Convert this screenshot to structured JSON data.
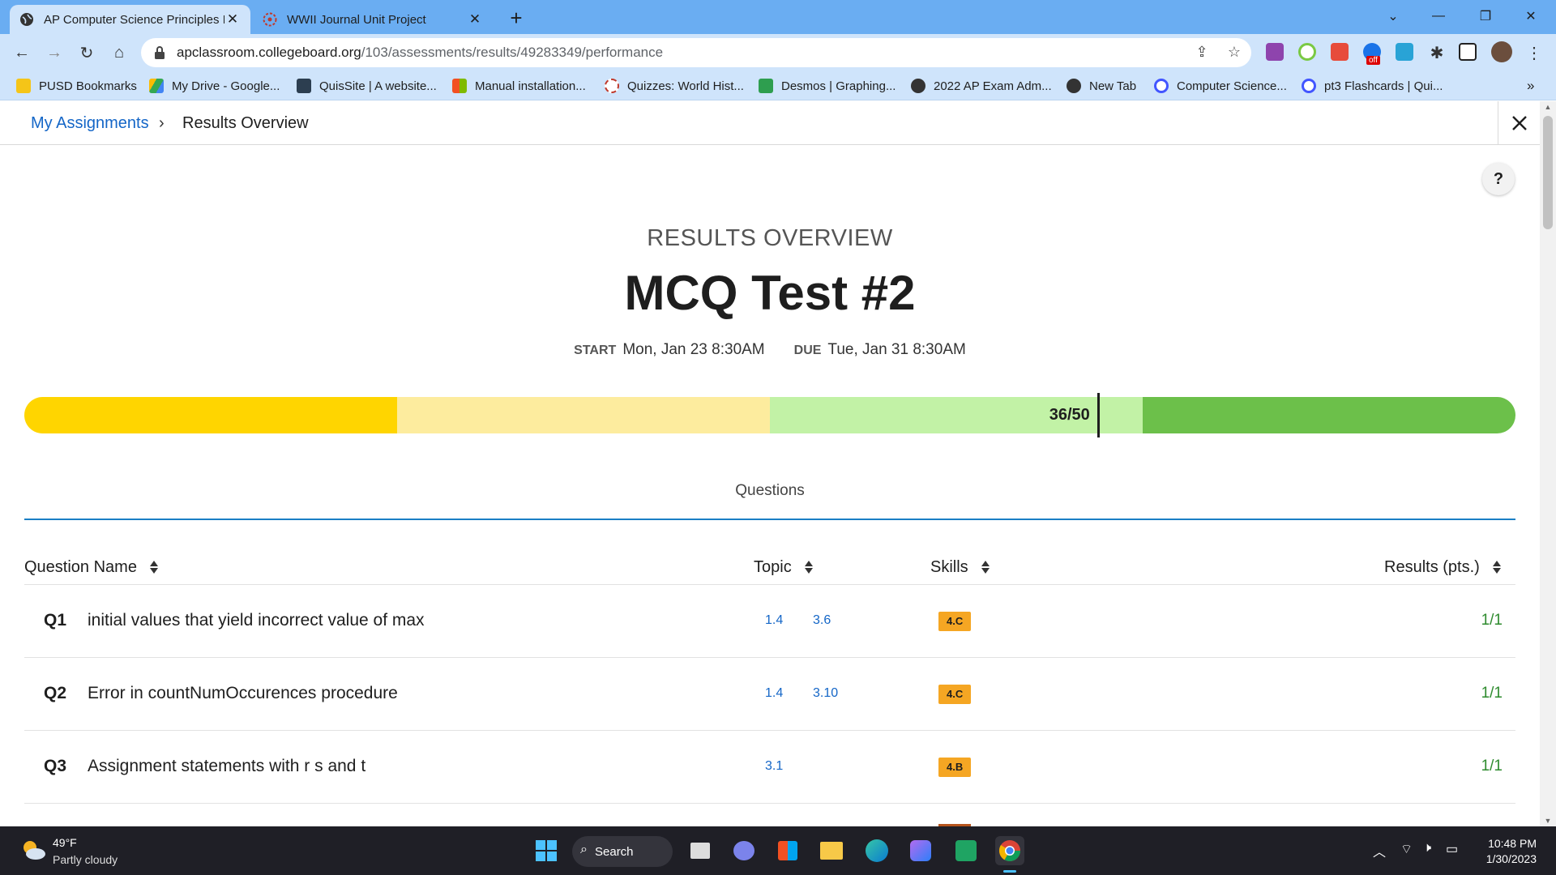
{
  "browser": {
    "tabs": [
      {
        "title": "AP Computer Science Principles I",
        "active": true
      },
      {
        "title": "WWII Journal Unit Project",
        "active": false
      }
    ],
    "new_tab": "+",
    "url_domain": "apclassroom.collegeboard.org",
    "url_path": "/103/assessments/results/49283349/performance",
    "bookmarks": [
      "PUSD Bookmarks",
      "My Drive - Google...",
      "QuisSite | A website...",
      "Manual installation...",
      "Quizzes: World Hist...",
      "Desmos | Graphing...",
      "2022 AP Exam Adm...",
      "New Tab",
      "Computer Science...",
      "pt3 Flashcards | Qui..."
    ],
    "bookmarks_overflow": "»",
    "extension_badge": "off"
  },
  "breadcrumb": {
    "link": "My Assignments",
    "separator": "›",
    "current": "Results Overview"
  },
  "help_label": "?",
  "header": {
    "overline": "RESULTS OVERVIEW",
    "title": "MCQ Test #2",
    "start_label": "START",
    "start_value": "Mon, Jan 23 8:30AM",
    "due_label": "DUE",
    "due_value": "Tue, Jan 31 8:30AM"
  },
  "score": {
    "label": "36/50",
    "earned": 36,
    "total": 50,
    "segment_colors": [
      "#ffd500",
      "#fdec9e",
      "#c2f2a6",
      "#6cc04a"
    ]
  },
  "questions_tab": "Questions",
  "table": {
    "columns": [
      "Question Name",
      "Topic",
      "Skills",
      "Results (pts.)"
    ],
    "rows": [
      {
        "num": "Q1",
        "name": "initial values that yield incorrect value of max",
        "topics": [
          "1.4",
          "3.6"
        ],
        "skill": "4.C",
        "result": "1/1"
      },
      {
        "num": "Q2",
        "name": "Error in countNumOccurences procedure",
        "topics": [
          "1.4",
          "3.10"
        ],
        "skill": "4.C",
        "result": "1/1"
      },
      {
        "num": "Q3",
        "name": "Assignment statements with r s and t",
        "topics": [
          "3.1"
        ],
        "skill": "4.B",
        "result": "1/1"
      }
    ]
  },
  "taskbar": {
    "temperature": "49°F",
    "condition": "Partly cloudy",
    "search": "Search",
    "time": "10:48 PM",
    "date": "1/30/2023"
  }
}
